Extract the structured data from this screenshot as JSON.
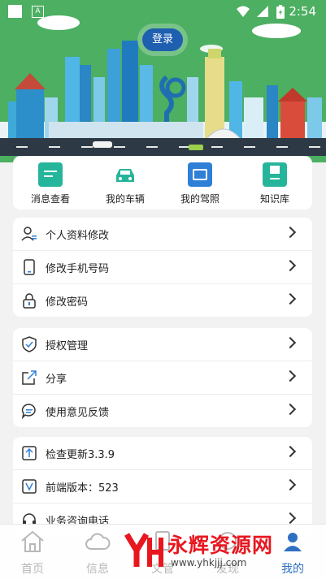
{
  "status_bar": {
    "time": "2:54",
    "notif_letter": "A"
  },
  "hero": {
    "login_label": "登录"
  },
  "quick_actions": [
    {
      "label": "消息查看",
      "icon": "message-icon"
    },
    {
      "label": "我的车辆",
      "icon": "car-icon"
    },
    {
      "label": "我的驾照",
      "icon": "license-icon"
    },
    {
      "label": "知识库",
      "icon": "book-icon"
    }
  ],
  "group1": [
    {
      "label": "个人资料修改",
      "icon": "user-edit-icon"
    },
    {
      "label": "修改手机号码",
      "icon": "phone-icon"
    },
    {
      "label": "修改密码",
      "icon": "lock-icon"
    }
  ],
  "group2": [
    {
      "label": "授权管理",
      "icon": "shield-icon"
    },
    {
      "label": "分享",
      "icon": "share-icon"
    },
    {
      "label": "使用意见反馈",
      "icon": "feedback-icon"
    }
  ],
  "group3": [
    {
      "label": "检查更新3.3.9",
      "icon": "update-icon"
    },
    {
      "label": "前端版本：523",
      "icon": "version-icon"
    },
    {
      "label": "业务咨询电话",
      "icon": "headset-icon"
    }
  ],
  "tabs": [
    {
      "label": "首页",
      "icon": "home-icon",
      "active": false
    },
    {
      "label": "信息",
      "icon": "cloud-icon",
      "active": false
    },
    {
      "label": "文管",
      "icon": "doc-icon",
      "active": false
    },
    {
      "label": "发现",
      "icon": "discover-icon",
      "active": false
    },
    {
      "label": "我的",
      "icon": "profile-icon",
      "active": true
    }
  ],
  "watermark": {
    "text": "永辉资源网",
    "url": "www.yhkjjj.com"
  },
  "colors": {
    "hero_green": "#4caf62",
    "accent_blue": "#2f6fc2",
    "icon_teal": "#25b59a",
    "icon_blue": "#2f7fd6"
  }
}
